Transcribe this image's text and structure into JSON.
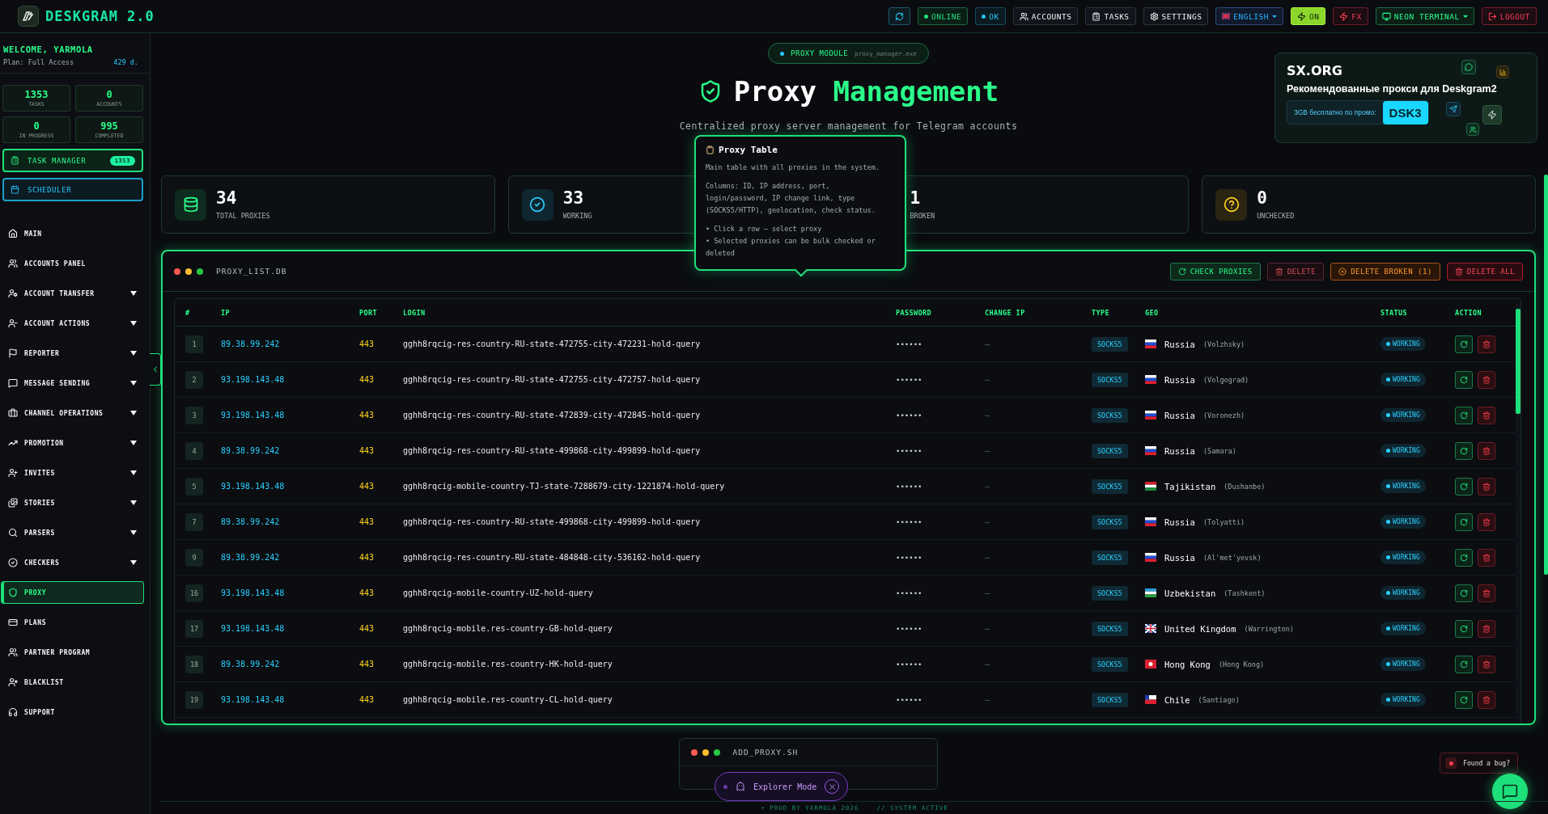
{
  "app": {
    "name": "DESKGRAM 2.0"
  },
  "top_bar": [
    {
      "kind": "refresh"
    },
    {
      "kind": "online",
      "label": "ONLINE"
    },
    {
      "kind": "ok",
      "label": "OK"
    },
    {
      "kind": "nav",
      "label": "ACCOUNTS"
    },
    {
      "kind": "nav",
      "label": "TASKS"
    },
    {
      "kind": "nav",
      "label": "SETTINGS"
    },
    {
      "kind": "lang",
      "label": "ENGLISH"
    },
    {
      "kind": "toggle",
      "label": "ON"
    },
    {
      "kind": "fx",
      "label": "FX"
    },
    {
      "kind": "theme",
      "label": "NEON TERMINAL"
    },
    {
      "kind": "logout",
      "label": "LOGOUT"
    }
  ],
  "sidebar": {
    "welcome": "WELCOME, YARMOLA",
    "plan": "Plan: Full Access",
    "days": "429 d.",
    "stats": [
      {
        "value": "1353",
        "label": "TASKS"
      },
      {
        "value": "0",
        "label": "ACCOUNTS"
      },
      {
        "value": "0",
        "label": "IN PROGRESS"
      },
      {
        "value": "995",
        "label": "COMPLETED"
      }
    ],
    "task_manager": {
      "label": "TASK MANAGER",
      "badge": "1353"
    },
    "scheduler": {
      "label": "SCHEDULER"
    },
    "items": [
      {
        "label": "MAIN",
        "expandable": false,
        "selected": false
      },
      {
        "label": "ACCOUNTS PANEL",
        "expandable": false,
        "selected": false
      },
      {
        "label": "ACCOUNT TRANSFER",
        "expandable": true,
        "selected": false
      },
      {
        "label": "ACCOUNT ACTIONS",
        "expandable": true,
        "selected": false
      },
      {
        "label": "REPORTER",
        "expandable": true,
        "selected": false
      },
      {
        "label": "MESSAGE SENDING",
        "expandable": true,
        "selected": false
      },
      {
        "label": "CHANNEL OPERATIONS",
        "expandable": true,
        "selected": false
      },
      {
        "label": "PROMOTION",
        "expandable": true,
        "selected": false
      },
      {
        "label": "INVITES",
        "expandable": true,
        "selected": false
      },
      {
        "label": "STORIES",
        "expandable": true,
        "selected": false
      },
      {
        "label": "PARSERS",
        "expandable": true,
        "selected": false
      },
      {
        "label": "CHECKERS",
        "expandable": true,
        "selected": false
      },
      {
        "label": "PROXY",
        "expandable": false,
        "selected": true
      },
      {
        "label": "PLANS",
        "expandable": false,
        "selected": false
      },
      {
        "label": "PARTNER PROGRAM",
        "expandable": false,
        "selected": false
      },
      {
        "label": "BLACKLIST",
        "expandable": false,
        "selected": false
      },
      {
        "label": "SUPPORT",
        "expandable": false,
        "selected": false
      }
    ]
  },
  "header": {
    "module": "PROXY MODULE",
    "file": "proxy_manager.exe",
    "title_first": "Proxy",
    "title_second": "Management",
    "subtitle": "Centralized proxy server management for Telegram accounts"
  },
  "promo": {
    "brand_first": "SX",
    "brand_second": ".ORG",
    "heading": "Рекомендованные прокси для Deskgram2",
    "offer": "3GB бесплатно по промо:",
    "code": "DSK3"
  },
  "stats": [
    {
      "kind": "total",
      "value": "34",
      "label": "TOTAL PROXIES"
    },
    {
      "kind": "working",
      "value": "33",
      "label": "WORKING"
    },
    {
      "kind": "broken",
      "value": "1",
      "label": "BROKEN"
    },
    {
      "kind": "unchecked",
      "value": "0",
      "label": "UNCHECKED"
    }
  ],
  "tooltip": {
    "title": "Proxy Table",
    "lines": [
      "Main table with all proxies in the system.",
      "Columns: ID, IP address, port, login/password, IP change link, type (SOCKS5/HTTP), geolocation, check status.",
      "• Click a row — select proxy\n• Selected proxies can be bulk checked or deleted"
    ]
  },
  "proxy_panel": {
    "title": "PROXY_LIST.DB",
    "actions": [
      {
        "kind": "check",
        "label": "CHECK PROXIES",
        "disabled": false
      },
      {
        "kind": "delete",
        "label": "DELETE",
        "disabled": true
      },
      {
        "kind": "broken",
        "label": "DELETE BROKEN (1)",
        "disabled": false
      },
      {
        "kind": "all",
        "label": "DELETE ALL",
        "disabled": false
      }
    ],
    "columns": [
      "#",
      "IP",
      "PORT",
      "LOGIN",
      "PASSWORD",
      "CHANGE IP",
      "TYPE",
      "GEO",
      "STATUS",
      "ACTION"
    ],
    "rows": [
      {
        "id": "1",
        "ip": "89.38.99.242",
        "port": "443",
        "login": "gghh8rqcig-res-country-RU-state-472755-city-472231-hold-query",
        "password": "••••••",
        "change_ip": "—",
        "type": "SOCKS5",
        "country": "Russia",
        "city": "(Volzhsky)",
        "status": "WORKING",
        "selected": false
      },
      {
        "id": "2",
        "ip": "93.198.143.48",
        "port": "443",
        "login": "gghh8rqcig-res-country-RU-state-472755-city-472757-hold-query",
        "password": "••••••",
        "change_ip": "—",
        "type": "SOCKS5",
        "country": "Russia",
        "city": "(Volgograd)",
        "status": "WORKING",
        "selected": false
      },
      {
        "id": "3",
        "ip": "93.198.143.48",
        "port": "443",
        "login": "gghh8rqcig-res-country-RU-state-472839-city-472845-hold-query",
        "password": "••••••",
        "change_ip": "—",
        "type": "SOCKS5",
        "country": "Russia",
        "city": "(Voronezh)",
        "status": "WORKING",
        "selected": false
      },
      {
        "id": "4",
        "ip": "89.38.99.242",
        "port": "443",
        "login": "gghh8rqcig-res-country-RU-state-499868-city-499899-hold-query",
        "password": "••••••",
        "change_ip": "—",
        "type": "SOCKS5",
        "country": "Russia",
        "city": "(Samara)",
        "status": "WORKING",
        "selected": false
      },
      {
        "id": "5",
        "ip": "93.198.143.48",
        "port": "443",
        "login": "gghh8rqcig-mobile-country-TJ-state-7288679-city-1221874-hold-query",
        "password": "••••••",
        "change_ip": "—",
        "type": "SOCKS5",
        "country": "Tajikistan",
        "city": "(Dushanbe)",
        "status": "WORKING",
        "selected": false
      },
      {
        "id": "7",
        "ip": "89.38.99.242",
        "port": "443",
        "login": "gghh8rqcig-res-country-RU-state-499868-city-499899-hold-query",
        "password": "••••••",
        "change_ip": "—",
        "type": "SOCKS5",
        "country": "Russia",
        "city": "(Tolyatti)",
        "status": "WORKING",
        "selected": false
      },
      {
        "id": "9",
        "ip": "89.38.99.242",
        "port": "443",
        "login": "gghh8rqcig-res-country-RU-state-484848-city-536162-hold-query",
        "password": "••••••",
        "change_ip": "—",
        "type": "SOCKS5",
        "country": "Russia",
        "city": "(Al'met'yevsk)",
        "status": "WORKING",
        "selected": false
      },
      {
        "id": "16",
        "ip": "93.198.143.48",
        "port": "443",
        "login": "gghh8rqcig-mobile-country-UZ-hold-query",
        "password": "••••••",
        "change_ip": "—",
        "type": "SOCKS5",
        "country": "Uzbekistan",
        "city": "(Tashkent)",
        "status": "WORKING",
        "selected": false
      },
      {
        "id": "17",
        "ip": "93.198.143.48",
        "port": "443",
        "login": "gghh8rqcig-mobile.res-country-GB-hold-query",
        "password": "••••••",
        "change_ip": "—",
        "type": "SOCKS5",
        "country": "United Kingdom",
        "city": "(Warrington)",
        "status": "WORKING",
        "selected": false
      },
      {
        "id": "18",
        "ip": "89.38.99.242",
        "port": "443",
        "login": "gghh8rqcig-mobile.res-country-HK-hold-query",
        "password": "••••••",
        "change_ip": "—",
        "type": "SOCKS5",
        "country": "Hong Kong",
        "city": "(Hong Kong)",
        "status": "WORKING",
        "selected": false
      },
      {
        "id": "19",
        "ip": "93.198.143.48",
        "port": "443",
        "login": "gghh8rqcig-mobile.res-country-CL-hold-query",
        "password": "••••••",
        "change_ip": "—",
        "type": "SOCKS5",
        "country": "Chile",
        "city": "(Santiago)",
        "status": "WORKING",
        "selected": false
      }
    ]
  },
  "add_panel": {
    "title": "ADD_PROXY.SH"
  },
  "explorer": {
    "label": "Explorer Mode"
  },
  "bug_button": {
    "label": "Found a bug?"
  },
  "footer": {
    "credit": "• PROD BY YARMOLA 2026",
    "status": "// SYSTEM ACTIVE"
  }
}
